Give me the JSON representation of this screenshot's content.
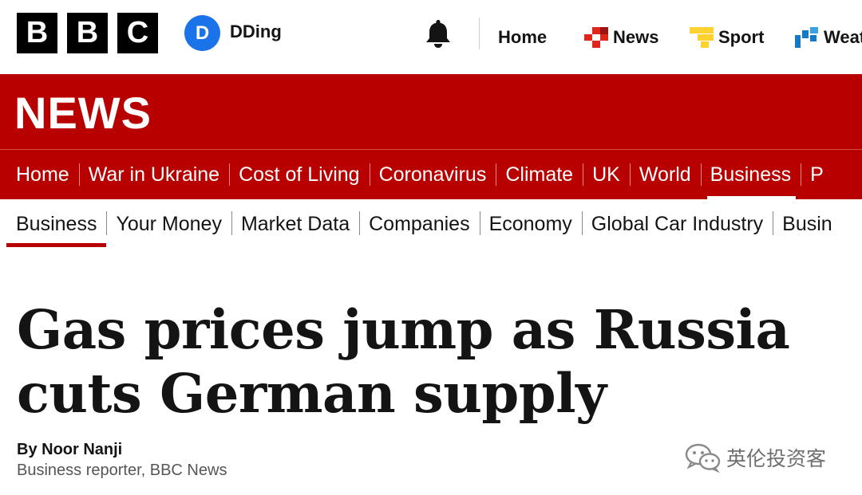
{
  "header": {
    "logo_letters": [
      "B",
      "B",
      "C"
    ],
    "avatar_initial": "D",
    "username": "DDing",
    "nav": [
      {
        "label": "Home",
        "icon": "none"
      },
      {
        "label": "News",
        "icon": "news-icon",
        "color": "#e1251b"
      },
      {
        "label": "Sport",
        "icon": "sport-icon",
        "color": "#ffd230"
      },
      {
        "label": "Weat",
        "icon": "weather-icon",
        "color": "#1479c8"
      }
    ]
  },
  "banner": {
    "title": "NEWS",
    "nav": [
      "Home",
      "War in Ukraine",
      "Cost of Living",
      "Coronavirus",
      "Climate",
      "UK",
      "World",
      "Business",
      "P"
    ],
    "active": "Business",
    "color": "#b80000"
  },
  "subnav": {
    "items": [
      "Business",
      "Your Money",
      "Market Data",
      "Companies",
      "Economy",
      "Global Car Industry",
      "Busin"
    ],
    "active": "Business"
  },
  "article": {
    "headline": "Gas prices jump as Russia cuts German supply",
    "byline": "By Noor Nanji",
    "role": "Business reporter, BBC News"
  },
  "watermark": {
    "text": "英伦投资客",
    "icon": "wechat-icon"
  }
}
